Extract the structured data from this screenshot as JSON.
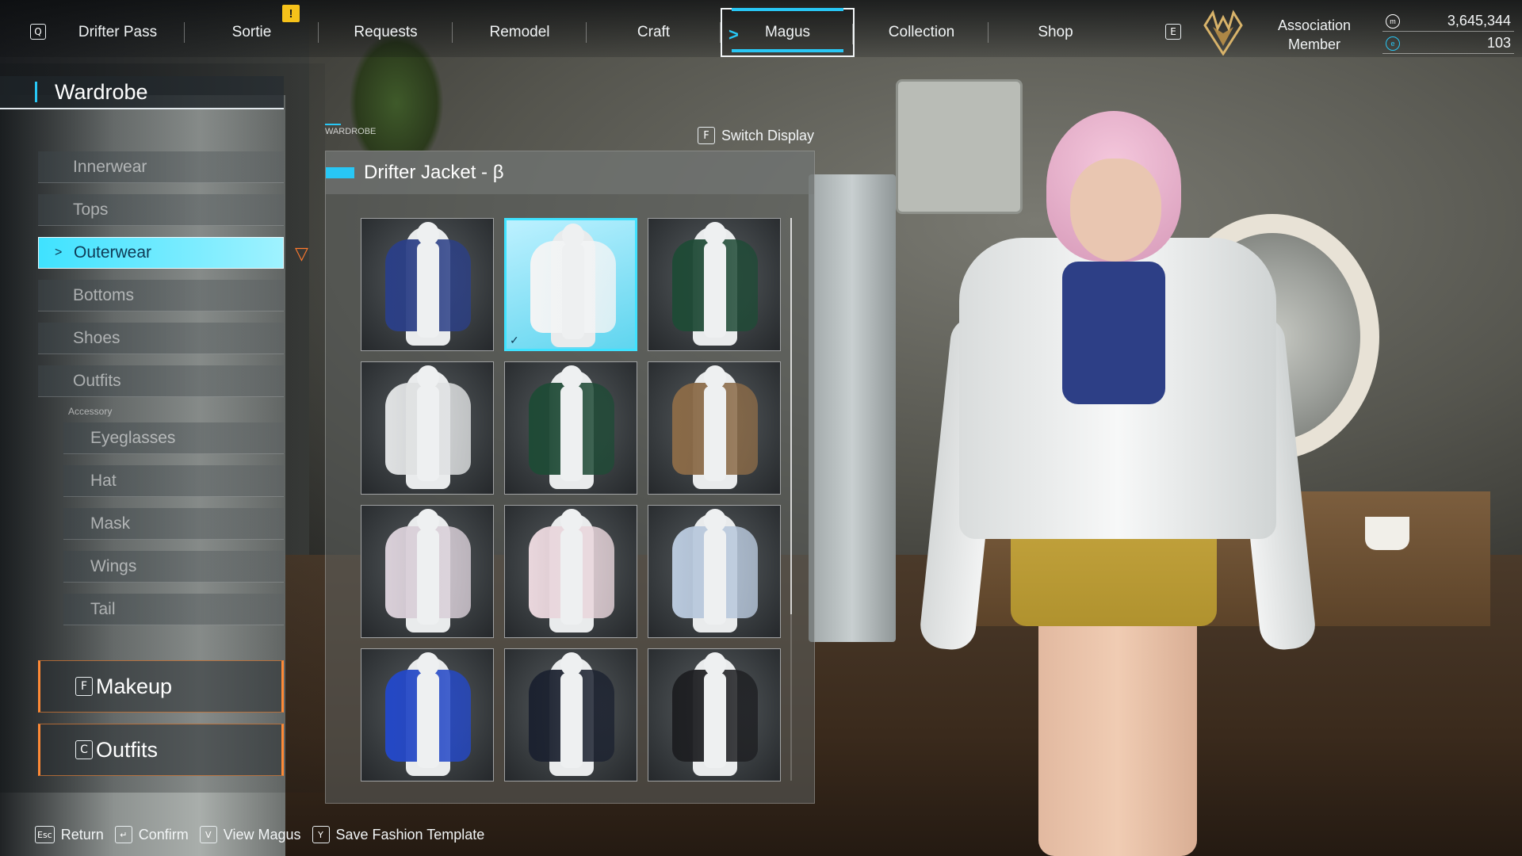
{
  "nav": {
    "left_key": "Q",
    "right_key": "E",
    "tabs": [
      {
        "label": "Drifter Pass"
      },
      {
        "label": "Sortie",
        "alert": "!"
      },
      {
        "label": "Requests"
      },
      {
        "label": "Remodel"
      },
      {
        "label": "Craft"
      },
      {
        "label": "Magus",
        "active": true
      },
      {
        "label": "Collection"
      },
      {
        "label": "Shop"
      }
    ]
  },
  "player": {
    "rank_line1": "Association",
    "rank_line2": "Member",
    "currency1": "3,645,344",
    "currency2": "103",
    "currency1_icon": "coin-icon",
    "currency2_icon": "gem-icon"
  },
  "wardrobe": {
    "title": "Wardrobe",
    "categories": [
      {
        "label": "Innerwear"
      },
      {
        "label": "Tops"
      },
      {
        "label": "Outerwear",
        "active": true
      },
      {
        "label": "Bottoms"
      },
      {
        "label": "Shoes"
      },
      {
        "label": "Outfits"
      }
    ],
    "accessory_label": "Accessory",
    "accessories": [
      {
        "label": "Eyeglasses"
      },
      {
        "label": "Hat"
      },
      {
        "label": "Mask"
      },
      {
        "label": "Wings"
      },
      {
        "label": "Tail"
      }
    ],
    "makeup": {
      "key": "F",
      "label": "Makeup"
    },
    "outfits": {
      "key": "C",
      "label": "Outfits"
    }
  },
  "panel": {
    "tag": "WARDROBE",
    "switch_key": "F",
    "switch_label": "Switch Display",
    "item_name": "Drifter Jacket - β",
    "items": [
      {
        "color": "#2b3f86",
        "selected": false
      },
      {
        "color": "#f2f4f5",
        "selected": true
      },
      {
        "color": "#1f4a36",
        "selected": false
      },
      {
        "color": "#dfe1e2",
        "selected": false
      },
      {
        "color": "#1f4a36",
        "selected": false
      },
      {
        "color": "#8a6a47",
        "selected": false
      },
      {
        "color": "#d9cfd8",
        "selected": false
      },
      {
        "color": "#e9d6dc",
        "selected": false
      },
      {
        "color": "#b8c8dc",
        "selected": false
      },
      {
        "color": "#2448c6",
        "selected": false
      },
      {
        "color": "#1c2230",
        "selected": false
      },
      {
        "color": "#1e1f22",
        "selected": false
      }
    ]
  },
  "hints": [
    {
      "key": "Esc",
      "label": "Return"
    },
    {
      "key": "↵",
      "label": "Confirm"
    },
    {
      "key": "V",
      "label": "View Magus"
    },
    {
      "key": "Y",
      "label": "Save Fashion Template"
    }
  ],
  "colors": {
    "accent": "#28c7f5",
    "highlight": "#3fe2ff",
    "orange": "#ff8a36",
    "alert": "#f6c21a"
  }
}
